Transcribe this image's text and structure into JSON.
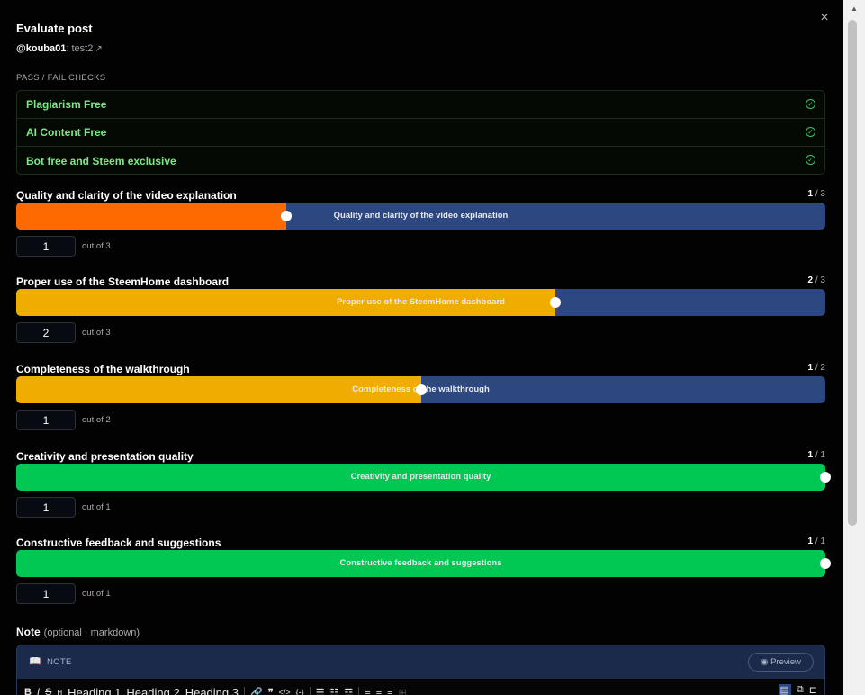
{
  "modal": {
    "title": "Evaluate post",
    "author": "@kouba01",
    "permlink": ": test2",
    "close_icon": "×"
  },
  "checks": {
    "heading": "PASS / FAIL CHECKS",
    "items": [
      {
        "label": "Plagiarism Free",
        "status": "pass"
      },
      {
        "label": "AI Content Free",
        "status": "pass"
      },
      {
        "label": "Bot free and Steem exclusive",
        "status": "pass"
      }
    ]
  },
  "criteria": [
    {
      "name": "Quality and clarity of the video explanation",
      "score": "1",
      "max": "/ 3",
      "value": "1",
      "out_of": "out of 3",
      "level": 0.3333,
      "color": "#ff6a00"
    },
    {
      "name": "Proper use of the SteemHome dashboard",
      "score": "2",
      "max": "/ 3",
      "value": "2",
      "out_of": "out of 3",
      "level": 0.6667,
      "color": "#f0ad00"
    },
    {
      "name": "Completeness of the walkthrough",
      "score": "1",
      "max": "/ 2",
      "value": "1",
      "out_of": "out of 2",
      "level": 0.5,
      "color": "#f0ad00"
    },
    {
      "name": "Creativity and presentation quality",
      "score": "1",
      "max": "/ 1",
      "value": "1",
      "out_of": "out of 1",
      "level": 1.0,
      "color": "#00c853"
    },
    {
      "name": "Constructive feedback and suggestions",
      "score": "1",
      "max": "/ 1",
      "value": "1",
      "out_of": "out of 1",
      "level": 1.0,
      "color": "#00c853"
    }
  ],
  "note": {
    "label": "Note",
    "hint": "(optional · markdown)",
    "editor_title": "NOTE",
    "preview_label": "Preview",
    "toolbar": {
      "heading1": "Heading 1",
      "heading2": "Heading 2",
      "heading3": "Heading 3"
    }
  },
  "colors": {
    "track": "#2d4780",
    "check_text": "#7ee787"
  }
}
